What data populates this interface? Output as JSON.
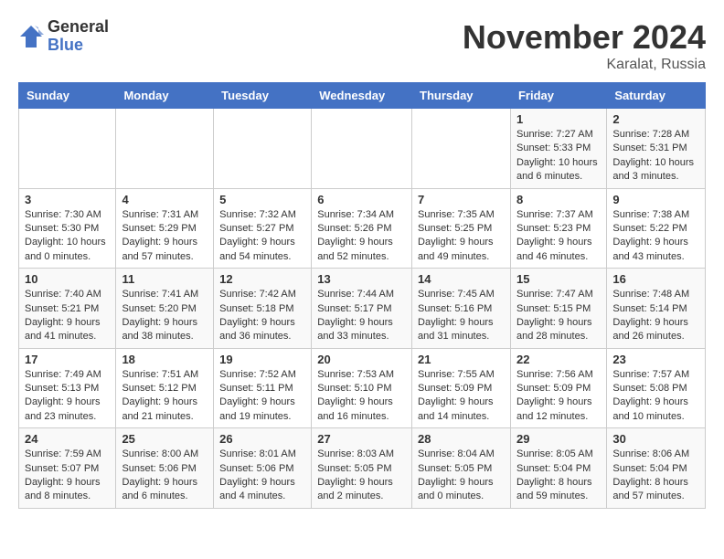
{
  "logo": {
    "general": "General",
    "blue": "Blue"
  },
  "title": "November 2024",
  "location": "Karalat, Russia",
  "days_of_week": [
    "Sunday",
    "Monday",
    "Tuesday",
    "Wednesday",
    "Thursday",
    "Friday",
    "Saturday"
  ],
  "weeks": [
    [
      {
        "day": "",
        "content": ""
      },
      {
        "day": "",
        "content": ""
      },
      {
        "day": "",
        "content": ""
      },
      {
        "day": "",
        "content": ""
      },
      {
        "day": "",
        "content": ""
      },
      {
        "day": "1",
        "content": "Sunrise: 7:27 AM\nSunset: 5:33 PM\nDaylight: 10 hours and 6 minutes."
      },
      {
        "day": "2",
        "content": "Sunrise: 7:28 AM\nSunset: 5:31 PM\nDaylight: 10 hours and 3 minutes."
      }
    ],
    [
      {
        "day": "3",
        "content": "Sunrise: 7:30 AM\nSunset: 5:30 PM\nDaylight: 10 hours and 0 minutes."
      },
      {
        "day": "4",
        "content": "Sunrise: 7:31 AM\nSunset: 5:29 PM\nDaylight: 9 hours and 57 minutes."
      },
      {
        "day": "5",
        "content": "Sunrise: 7:32 AM\nSunset: 5:27 PM\nDaylight: 9 hours and 54 minutes."
      },
      {
        "day": "6",
        "content": "Sunrise: 7:34 AM\nSunset: 5:26 PM\nDaylight: 9 hours and 52 minutes."
      },
      {
        "day": "7",
        "content": "Sunrise: 7:35 AM\nSunset: 5:25 PM\nDaylight: 9 hours and 49 minutes."
      },
      {
        "day": "8",
        "content": "Sunrise: 7:37 AM\nSunset: 5:23 PM\nDaylight: 9 hours and 46 minutes."
      },
      {
        "day": "9",
        "content": "Sunrise: 7:38 AM\nSunset: 5:22 PM\nDaylight: 9 hours and 43 minutes."
      }
    ],
    [
      {
        "day": "10",
        "content": "Sunrise: 7:40 AM\nSunset: 5:21 PM\nDaylight: 9 hours and 41 minutes."
      },
      {
        "day": "11",
        "content": "Sunrise: 7:41 AM\nSunset: 5:20 PM\nDaylight: 9 hours and 38 minutes."
      },
      {
        "day": "12",
        "content": "Sunrise: 7:42 AM\nSunset: 5:18 PM\nDaylight: 9 hours and 36 minutes."
      },
      {
        "day": "13",
        "content": "Sunrise: 7:44 AM\nSunset: 5:17 PM\nDaylight: 9 hours and 33 minutes."
      },
      {
        "day": "14",
        "content": "Sunrise: 7:45 AM\nSunset: 5:16 PM\nDaylight: 9 hours and 31 minutes."
      },
      {
        "day": "15",
        "content": "Sunrise: 7:47 AM\nSunset: 5:15 PM\nDaylight: 9 hours and 28 minutes."
      },
      {
        "day": "16",
        "content": "Sunrise: 7:48 AM\nSunset: 5:14 PM\nDaylight: 9 hours and 26 minutes."
      }
    ],
    [
      {
        "day": "17",
        "content": "Sunrise: 7:49 AM\nSunset: 5:13 PM\nDaylight: 9 hours and 23 minutes."
      },
      {
        "day": "18",
        "content": "Sunrise: 7:51 AM\nSunset: 5:12 PM\nDaylight: 9 hours and 21 minutes."
      },
      {
        "day": "19",
        "content": "Sunrise: 7:52 AM\nSunset: 5:11 PM\nDaylight: 9 hours and 19 minutes."
      },
      {
        "day": "20",
        "content": "Sunrise: 7:53 AM\nSunset: 5:10 PM\nDaylight: 9 hours and 16 minutes."
      },
      {
        "day": "21",
        "content": "Sunrise: 7:55 AM\nSunset: 5:09 PM\nDaylight: 9 hours and 14 minutes."
      },
      {
        "day": "22",
        "content": "Sunrise: 7:56 AM\nSunset: 5:09 PM\nDaylight: 9 hours and 12 minutes."
      },
      {
        "day": "23",
        "content": "Sunrise: 7:57 AM\nSunset: 5:08 PM\nDaylight: 9 hours and 10 minutes."
      }
    ],
    [
      {
        "day": "24",
        "content": "Sunrise: 7:59 AM\nSunset: 5:07 PM\nDaylight: 9 hours and 8 minutes."
      },
      {
        "day": "25",
        "content": "Sunrise: 8:00 AM\nSunset: 5:06 PM\nDaylight: 9 hours and 6 minutes."
      },
      {
        "day": "26",
        "content": "Sunrise: 8:01 AM\nSunset: 5:06 PM\nDaylight: 9 hours and 4 minutes."
      },
      {
        "day": "27",
        "content": "Sunrise: 8:03 AM\nSunset: 5:05 PM\nDaylight: 9 hours and 2 minutes."
      },
      {
        "day": "28",
        "content": "Sunrise: 8:04 AM\nSunset: 5:05 PM\nDaylight: 9 hours and 0 minutes."
      },
      {
        "day": "29",
        "content": "Sunrise: 8:05 AM\nSunset: 5:04 PM\nDaylight: 8 hours and 59 minutes."
      },
      {
        "day": "30",
        "content": "Sunrise: 8:06 AM\nSunset: 5:04 PM\nDaylight: 8 hours and 57 minutes."
      }
    ]
  ]
}
